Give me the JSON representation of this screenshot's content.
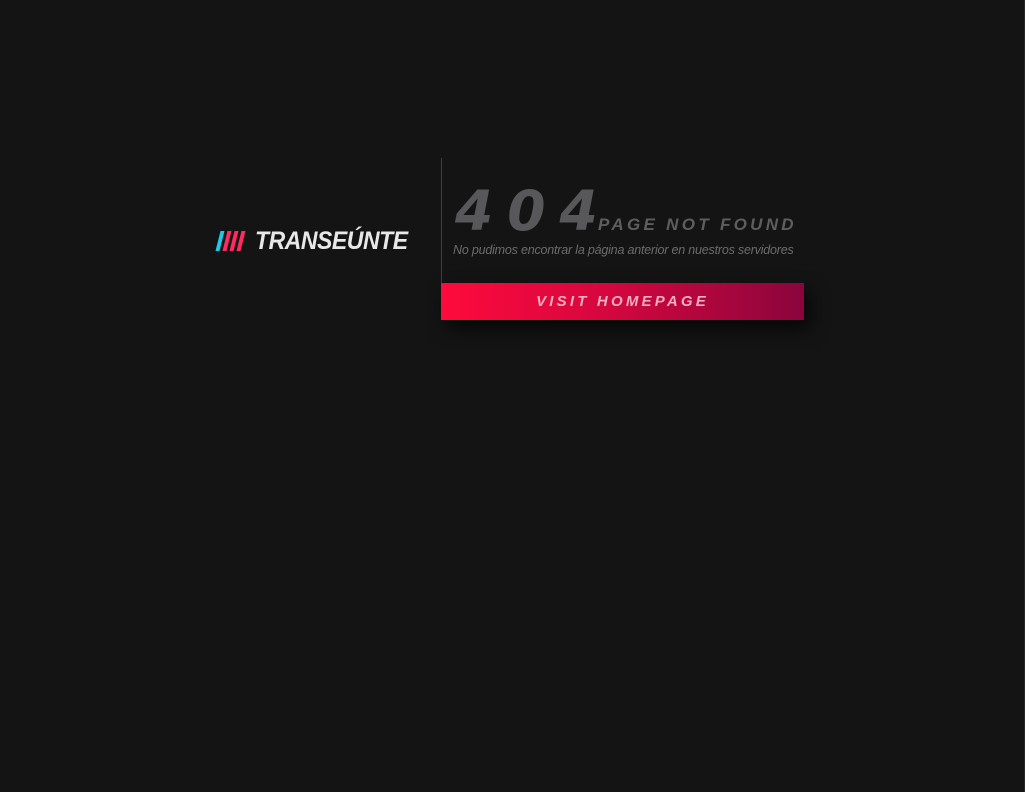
{
  "brand": {
    "name": "TRANSEÚNTE",
    "stripe_colors": [
      "#1ec8e6",
      "#ff2a5f",
      "#ff2a5f",
      "#ff2a5f"
    ]
  },
  "error": {
    "code": "404",
    "title": "PAGE NOT FOUND",
    "message": "No pudimos encontrar la página anterior en nuestros servidores"
  },
  "actions": {
    "home_label": "VISIT HOMEPAGE"
  },
  "colors": {
    "background": "#141415",
    "accent_start": "#ff0a3c",
    "accent_end": "#8a053c"
  }
}
